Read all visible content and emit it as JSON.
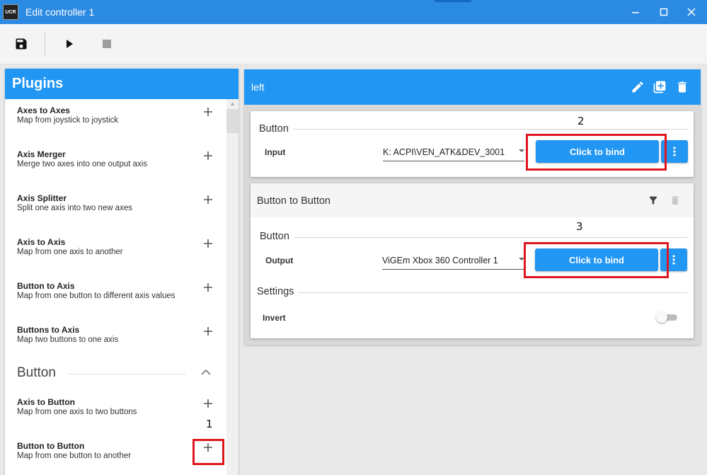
{
  "window": {
    "app_icon_text": "UCR",
    "title": "Edit controller 1",
    "controls": {
      "minimize": "—",
      "maximize": "☐",
      "close": "✕"
    }
  },
  "toolbar": {
    "save_icon": "save-icon",
    "play_icon": "play-icon",
    "stop_icon": "stop-icon"
  },
  "plugins": {
    "title": "Plugins",
    "items": [
      {
        "name": "Axes to Axes",
        "desc": "Map from joystick to joystick"
      },
      {
        "name": "Axis Merger",
        "desc": "Merge two axes into one output axis"
      },
      {
        "name": "Axis Splitter",
        "desc": "Split one axis into two new axes"
      },
      {
        "name": "Axis to Axis",
        "desc": "Map from one axis to another"
      },
      {
        "name": "Button to Axis",
        "desc": "Map from one button to different axis values"
      },
      {
        "name": "Buttons to Axis",
        "desc": "Map two buttons to one axis"
      },
      {
        "name": "Axis to Button",
        "desc": "Map from one axis to two buttons"
      },
      {
        "name": "Button to Button",
        "desc": "Map from one button to another"
      }
    ],
    "section_button": "Button"
  },
  "profile": {
    "title": "left",
    "input_card": {
      "section": "Button",
      "label": "Input",
      "select_value": "K: ACPI\\VEN_ATK&DEV_3001",
      "bind_label": "Click to bind",
      "annotation": "2"
    },
    "plugin_card": {
      "title": "Button to Button",
      "section": "Button",
      "label": "Output",
      "select_value": "ViGEm Xbox 360 Controller 1",
      "bind_label": "Click to bind",
      "annotation": "3",
      "settings_title": "Settings",
      "invert_label": "Invert",
      "invert_value": false
    },
    "plus_annotation": "1"
  },
  "colors": {
    "accent": "#2196f3",
    "titlebar": "#2b8ae2",
    "highlight": "#e0161f"
  }
}
